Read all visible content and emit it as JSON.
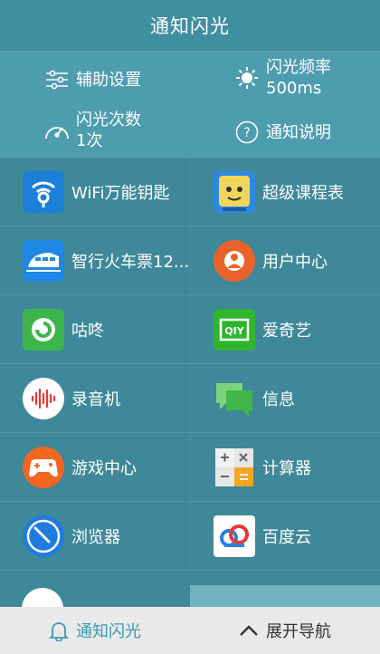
{
  "header": {
    "title": "通知闪光"
  },
  "settings": {
    "assist": "辅助设置",
    "freq_label": "闪光频率",
    "freq_value": "500ms",
    "count_label": "闪光次数",
    "count_value": "1次",
    "help": "通知说明"
  },
  "apps": [
    {
      "label": "WiFi万能钥匙",
      "icon": "wifi-key-icon"
    },
    {
      "label": "超级课程表",
      "icon": "course-schedule-icon"
    },
    {
      "label": "智行火车票12...",
      "icon": "train-ticket-icon"
    },
    {
      "label": "用户中心",
      "icon": "user-center-icon"
    },
    {
      "label": "咕咚",
      "icon": "codoon-icon"
    },
    {
      "label": "爱奇艺",
      "icon": "iqiyi-icon"
    },
    {
      "label": "录音机",
      "icon": "recorder-icon"
    },
    {
      "label": "信息",
      "icon": "messages-icon"
    },
    {
      "label": "游戏中心",
      "icon": "game-center-icon"
    },
    {
      "label": "计算器",
      "icon": "calculator-icon"
    },
    {
      "label": "浏览器",
      "icon": "browser-icon"
    },
    {
      "label": "百度云",
      "icon": "baidu-cloud-icon"
    }
  ],
  "bottom_nav": {
    "flash_tab": "通知闪光",
    "expand_tab": "展开导航"
  },
  "colors": {
    "header_bg": "#3f8fa0",
    "settings_bg": "#4d9daf",
    "apps_bg": "#3f8899",
    "active_tab": "#3a9bb0",
    "bottom_bg": "#e9e9e9"
  }
}
